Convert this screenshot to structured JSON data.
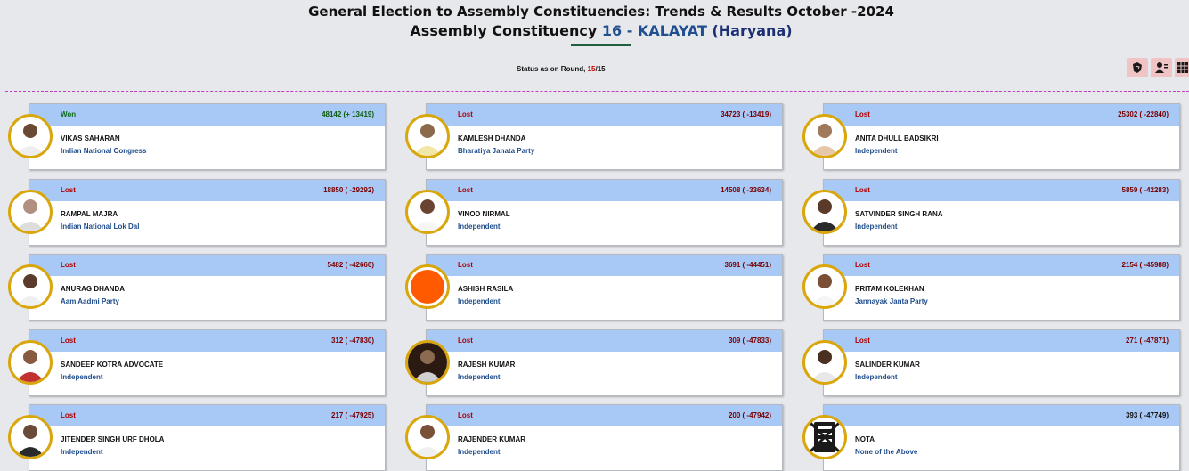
{
  "header": {
    "title": "General Election to Assembly Constituencies: Trends & Results October -2024",
    "ac_prefix": "Assembly Constituency",
    "ac_number_name": "16 - KALAYAT",
    "ac_state": "(Haryana)"
  },
  "status": {
    "label": "Status as on Round, ",
    "round_current": "15",
    "round_total": "/15"
  },
  "toolbar": {
    "icons": [
      "map-icon",
      "candidate-icon",
      "table-icon"
    ],
    "accent": "#f0c4c4"
  },
  "candidates": [
    {
      "status": "Won",
      "votes": "48142 (+ 13419)",
      "name": "VIKAS SAHARAN",
      "party": "Indian National Congress",
      "photo": "photo"
    },
    {
      "status": "Lost",
      "votes": "34723 ( -13419)",
      "name": "KAMLESH DHANDA",
      "party": "Bharatiya Janata Party",
      "photo": "photo"
    },
    {
      "status": "Lost",
      "votes": "25302 ( -22840)",
      "name": "ANITA DHULL BADSIKRI",
      "party": "Independent",
      "photo": "photo"
    },
    {
      "status": "Lost",
      "votes": "18850 ( -29292)",
      "name": "RAMPAL MAJRA",
      "party": "Indian National Lok Dal",
      "photo": "photo"
    },
    {
      "status": "Lost",
      "votes": "14508 ( -33634)",
      "name": "VINOD NIRMAL",
      "party": "Independent",
      "photo": "photo"
    },
    {
      "status": "Lost",
      "votes": "5859 ( -42283)",
      "name": "SATVINDER SINGH RANA",
      "party": "Independent",
      "photo": "photo"
    },
    {
      "status": "Lost",
      "votes": "5482 ( -42660)",
      "name": "ANURAG DHANDA",
      "party": "Aam Aadmi Party",
      "photo": "photo"
    },
    {
      "status": "Lost",
      "votes": "3691 ( -44451)",
      "name": "ASHISH RASILA",
      "party": "Independent",
      "photo": "orange"
    },
    {
      "status": "Lost",
      "votes": "2154 ( -45988)",
      "name": "PRITAM KOLEKHAN",
      "party": "Jannayak Janta Party",
      "photo": "photo"
    },
    {
      "status": "Lost",
      "votes": "312 ( -47830)",
      "name": "SANDEEP KOTRA ADVOCATE",
      "party": "Independent",
      "photo": "photo"
    },
    {
      "status": "Lost",
      "votes": "309 ( -47833)",
      "name": "RAJESH KUMAR",
      "party": "Independent",
      "photo": "photo"
    },
    {
      "status": "Lost",
      "votes": "271 ( -47871)",
      "name": "SALINDER KUMAR",
      "party": "Independent",
      "photo": "photo"
    },
    {
      "status": "Lost",
      "votes": "217 ( -47925)",
      "name": "JITENDER SINGH URF DHOLA",
      "party": "Independent",
      "photo": "photo"
    },
    {
      "status": "Lost",
      "votes": "200 ( -47942)",
      "name": "RAJENDER KUMAR",
      "party": "Independent",
      "photo": "photo"
    },
    {
      "status": "",
      "votes": "393 ( -47749)",
      "name": "NOTA",
      "party": "None of the Above",
      "photo": "nota"
    }
  ]
}
